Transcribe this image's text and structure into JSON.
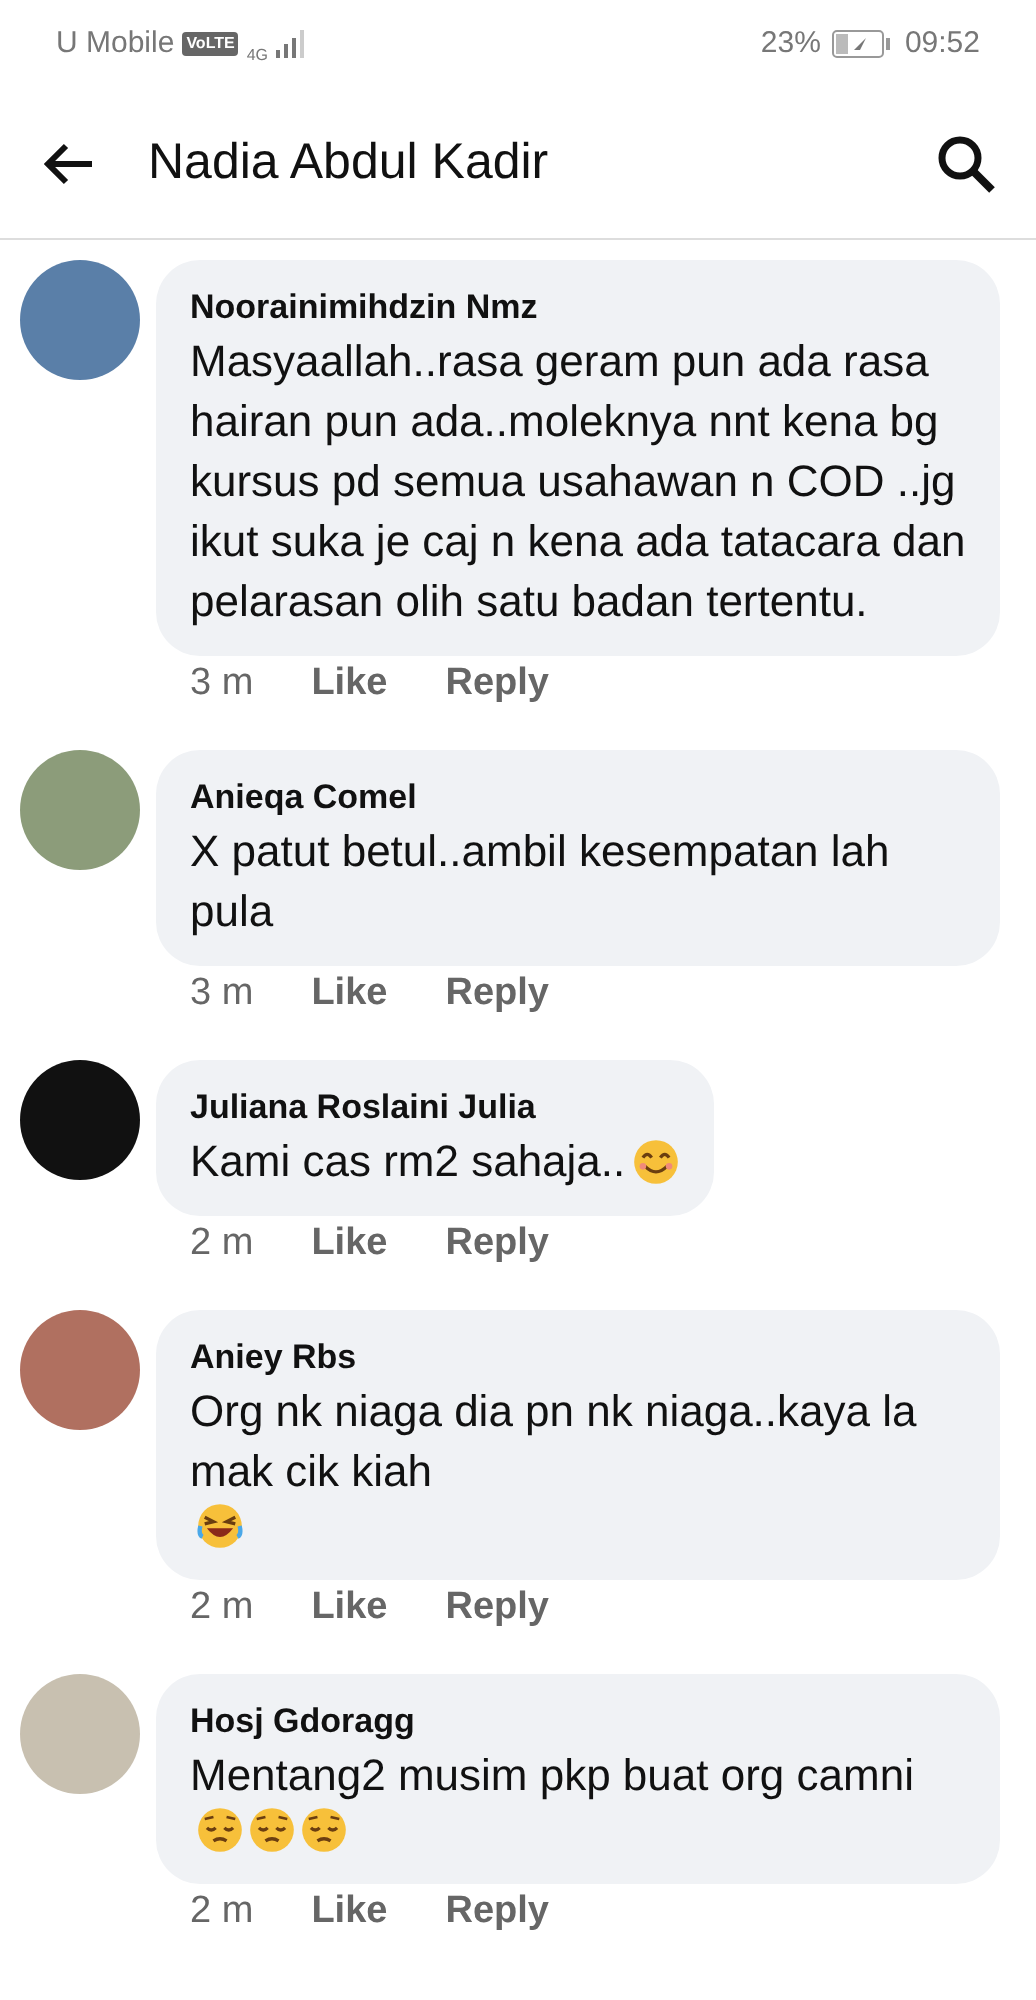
{
  "status_bar": {
    "carrier": "U Mobile",
    "volte": "VoLTE",
    "network": "4G",
    "battery": "23%",
    "time": "09:52"
  },
  "header": {
    "title": "Nadia Abdul Kadir"
  },
  "comments": [
    {
      "author": "Noorainimihdzin Nmz",
      "text": "Masyaallah..rasa geram pun ada rasa hairan pun ada..moleknya nnt kena bg kursus pd semua usahawan n COD ..jg ikut suka je caj n kena ada tatacara dan pelarasan olih satu badan tertentu.",
      "time": "3 m",
      "like": "Like",
      "reply": "Reply"
    },
    {
      "author": "Anieqa Comel",
      "text": "X patut betul..ambil kesempatan lah pula",
      "time": "3 m",
      "like": "Like",
      "reply": "Reply"
    },
    {
      "author": "Juliana Roslaini Julia",
      "text": "Kami cas rm2 sahaja..",
      "emojis": [
        {
          "kind": "smiling"
        }
      ],
      "time": "2 m",
      "like": "Like",
      "reply": "Reply"
    },
    {
      "author": "Aniey Rbs",
      "text": "Org nk niaga dia pn nk niaga..kaya la mak cik kiah",
      "emojis": [
        {
          "kind": "laughing"
        }
      ],
      "time": "2 m",
      "like": "Like",
      "reply": "Reply"
    },
    {
      "author": "Hosj Gdoragg",
      "text": "Mentang2 musim pkp buat org camni",
      "emojis": [
        {
          "kind": "pensive"
        },
        {
          "kind": "pensive"
        },
        {
          "kind": "pensive"
        }
      ],
      "time": "2 m",
      "like": "Like",
      "reply": "Reply"
    }
  ]
}
